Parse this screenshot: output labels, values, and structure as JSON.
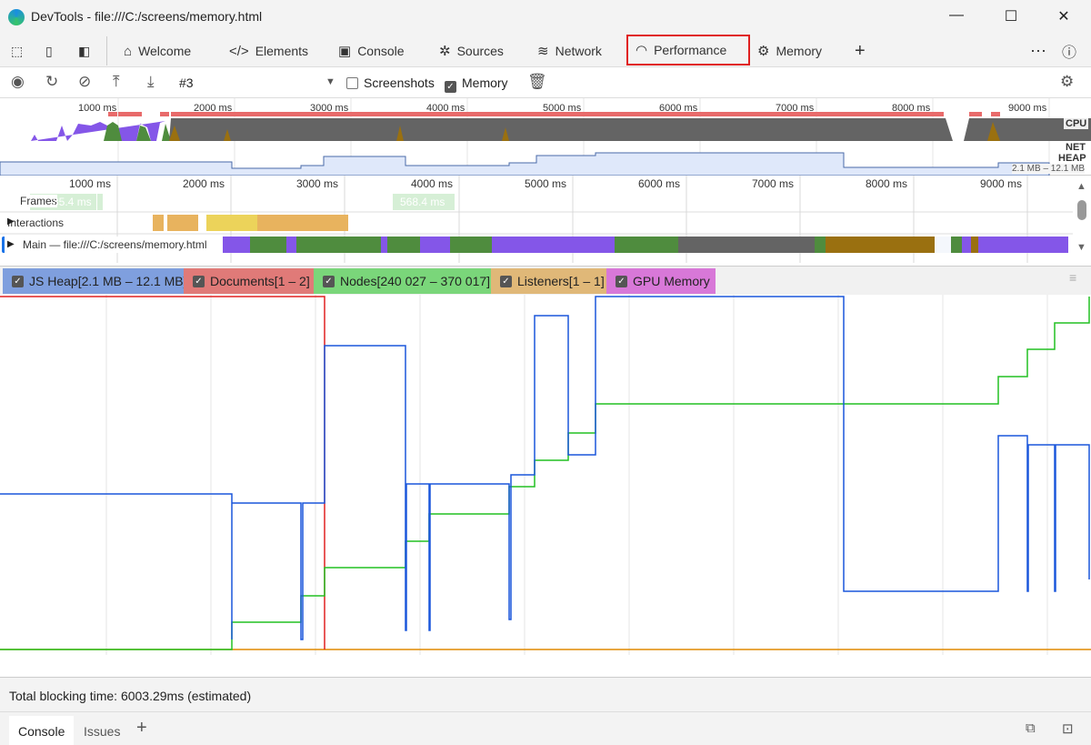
{
  "window": {
    "title": "DevTools - file:///C:/screens/memory.html",
    "minimize_icon": "minimize-icon",
    "maximize_icon": "maximize-icon",
    "close_icon": "close-icon"
  },
  "tabs": [
    {
      "label": "Welcome",
      "icon": "home-icon"
    },
    {
      "label": "Elements",
      "icon": "code-icon"
    },
    {
      "label": "Console",
      "icon": "console-icon"
    },
    {
      "label": "Sources",
      "icon": "bug-icon"
    },
    {
      "label": "Network",
      "icon": "wifi-icon"
    },
    {
      "label": "Performance",
      "icon": "gauge-icon",
      "active": true
    },
    {
      "label": "Memory",
      "icon": "chip-icon"
    }
  ],
  "toolbar": {
    "recording": "#3",
    "screenshots_label": "Screenshots",
    "screenshots_checked": false,
    "memory_label": "Memory",
    "memory_checked": true
  },
  "overview": {
    "ticks": [
      "1000 ms",
      "2000 ms",
      "3000 ms",
      "4000 ms",
      "5000 ms",
      "6000 ms",
      "7000 ms",
      "8000 ms",
      "9000 ms"
    ],
    "cpu_label": "CPU",
    "net_label": "NET",
    "heap_label": "HEAP",
    "heap_range": "2.1 MB – 12.1 MB"
  },
  "timeline": {
    "ticks": [
      "1000 ms",
      "2000 ms",
      "3000 ms",
      "4000 ms",
      "5000 ms",
      "6000 ms",
      "7000 ms",
      "8000 ms",
      "9000 ms"
    ],
    "frames_label": "Frames",
    "frame1": "35.4 ms",
    "frame2": "568.4 ms",
    "interactions_label": "Interactions",
    "main_label": "Main — file:///C:/screens/memory.html"
  },
  "counters": [
    {
      "label": "JS Heap[2.1 MB – 12.1 MB]",
      "color": "#7f9fde",
      "line": "#1a56db",
      "checked": true
    },
    {
      "label": "Documents[1 – 2]",
      "color": "#e07a78",
      "line": "#e02020",
      "checked": true
    },
    {
      "label": "Nodes[240 027 – 370 017]",
      "color": "#7ad67a",
      "line": "#22c022",
      "checked": true
    },
    {
      "label": "Listeners[1 – 1]",
      "color": "#e0b878",
      "line": "#e08a00",
      "checked": true
    },
    {
      "label": "GPU Memory",
      "color": "#d878d8",
      "checked": true
    }
  ],
  "status": {
    "text": "Total blocking time: 6003.29ms (estimated)"
  },
  "drawer": {
    "tabs": [
      "Console",
      "Issues"
    ]
  },
  "accent": {
    "highlight": "#e02020"
  }
}
